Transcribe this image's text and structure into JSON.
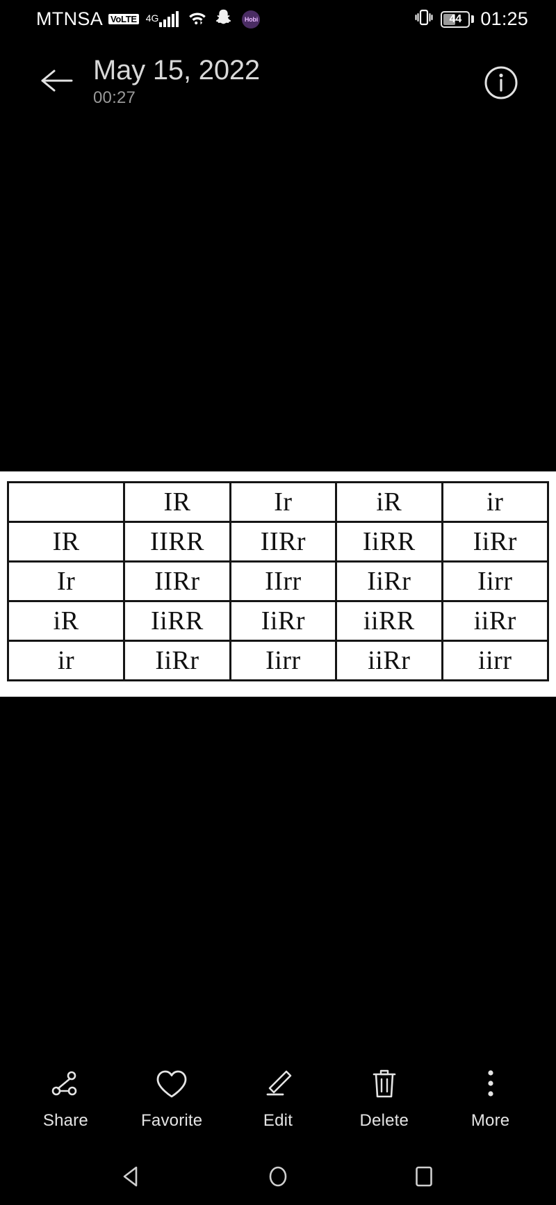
{
  "status_bar": {
    "carrier": "MTNSA",
    "volte": "VoLTE",
    "network_type": "4G",
    "signal_icon": "signal-bars-icon",
    "wifi_icon": "wifi-icon",
    "snapchat_icon": "snapchat-icon",
    "hobi_label": "Hobi",
    "vibrate_icon": "vibrate-icon",
    "battery_level": "44",
    "battery_percent": 44,
    "clock": "01:25"
  },
  "header": {
    "back_icon": "back-arrow-icon",
    "title": "May 15, 2022",
    "subtitle": "00:27",
    "info_icon": "info-icon"
  },
  "photo": {
    "kind": "punnett-square-image",
    "background": "#ffffff",
    "table": {
      "header_row": [
        "",
        "IR",
        "Ir",
        "iR",
        "ir"
      ],
      "rows": [
        {
          "label": "IR",
          "cells": [
            "IIRR",
            "IIRr",
            "IiRR",
            "IiRr"
          ]
        },
        {
          "label": "Ir",
          "cells": [
            "IIRr",
            "IIrr",
            "IiRr",
            "Iirr"
          ]
        },
        {
          "label": "iR",
          "cells": [
            "IiRR",
            "IiRr",
            "iiRR",
            "iiRr"
          ]
        },
        {
          "label": "ir",
          "cells": [
            "IiRr",
            "Iirr",
            "iiRr",
            "iirr"
          ]
        }
      ]
    }
  },
  "toolbar": {
    "items": [
      {
        "label": "Share",
        "icon": "share-icon"
      },
      {
        "label": "Favorite",
        "icon": "heart-icon"
      },
      {
        "label": "Edit",
        "icon": "pencil-icon"
      },
      {
        "label": "Delete",
        "icon": "trash-icon"
      },
      {
        "label": "More",
        "icon": "more-vertical-icon"
      }
    ]
  },
  "navbar": {
    "back_icon": "nav-back-triangle-icon",
    "home_icon": "nav-home-circle-icon",
    "recents_icon": "nav-recents-square-icon"
  },
  "colors": {
    "background": "#000000",
    "text_primary": "#ffffff",
    "text_secondary": "#9a9a9a",
    "photo_background": "#ffffff",
    "table_border": "#151515"
  }
}
